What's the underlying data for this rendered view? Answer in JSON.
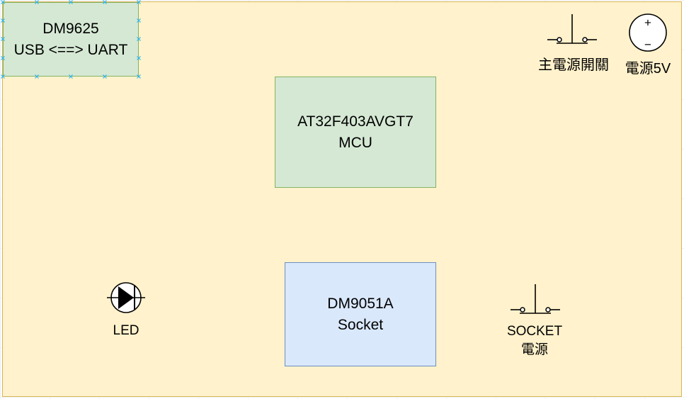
{
  "blocks": {
    "usb_uart": {
      "line1": "DM9625",
      "line2": "USB <==> UART"
    },
    "mcu": {
      "line1": "AT32F403AVGT7",
      "line2": "MCU"
    },
    "socket": {
      "line1": "DM9051A",
      "line2": "Socket"
    }
  },
  "components": {
    "main_power_switch": "主電源開關",
    "power_source": "電源5V",
    "power_source_plus": "+",
    "power_source_minus": "−",
    "led": "LED",
    "socket_power_line1": "SOCKET",
    "socket_power_line2": "電源"
  },
  "colors": {
    "board_fill": "#fff2cc",
    "board_stroke": "#d6b656",
    "green_fill": "#d5e8d4",
    "green_stroke": "#82b366",
    "blue_fill": "#dae8fc",
    "blue_stroke": "#6c8ebf",
    "selection_handle": "#29b6f2"
  },
  "icons": [
    "push-switch-icon",
    "voltage-source-icon",
    "led-diode-icon",
    "selection-handle-icon"
  ]
}
